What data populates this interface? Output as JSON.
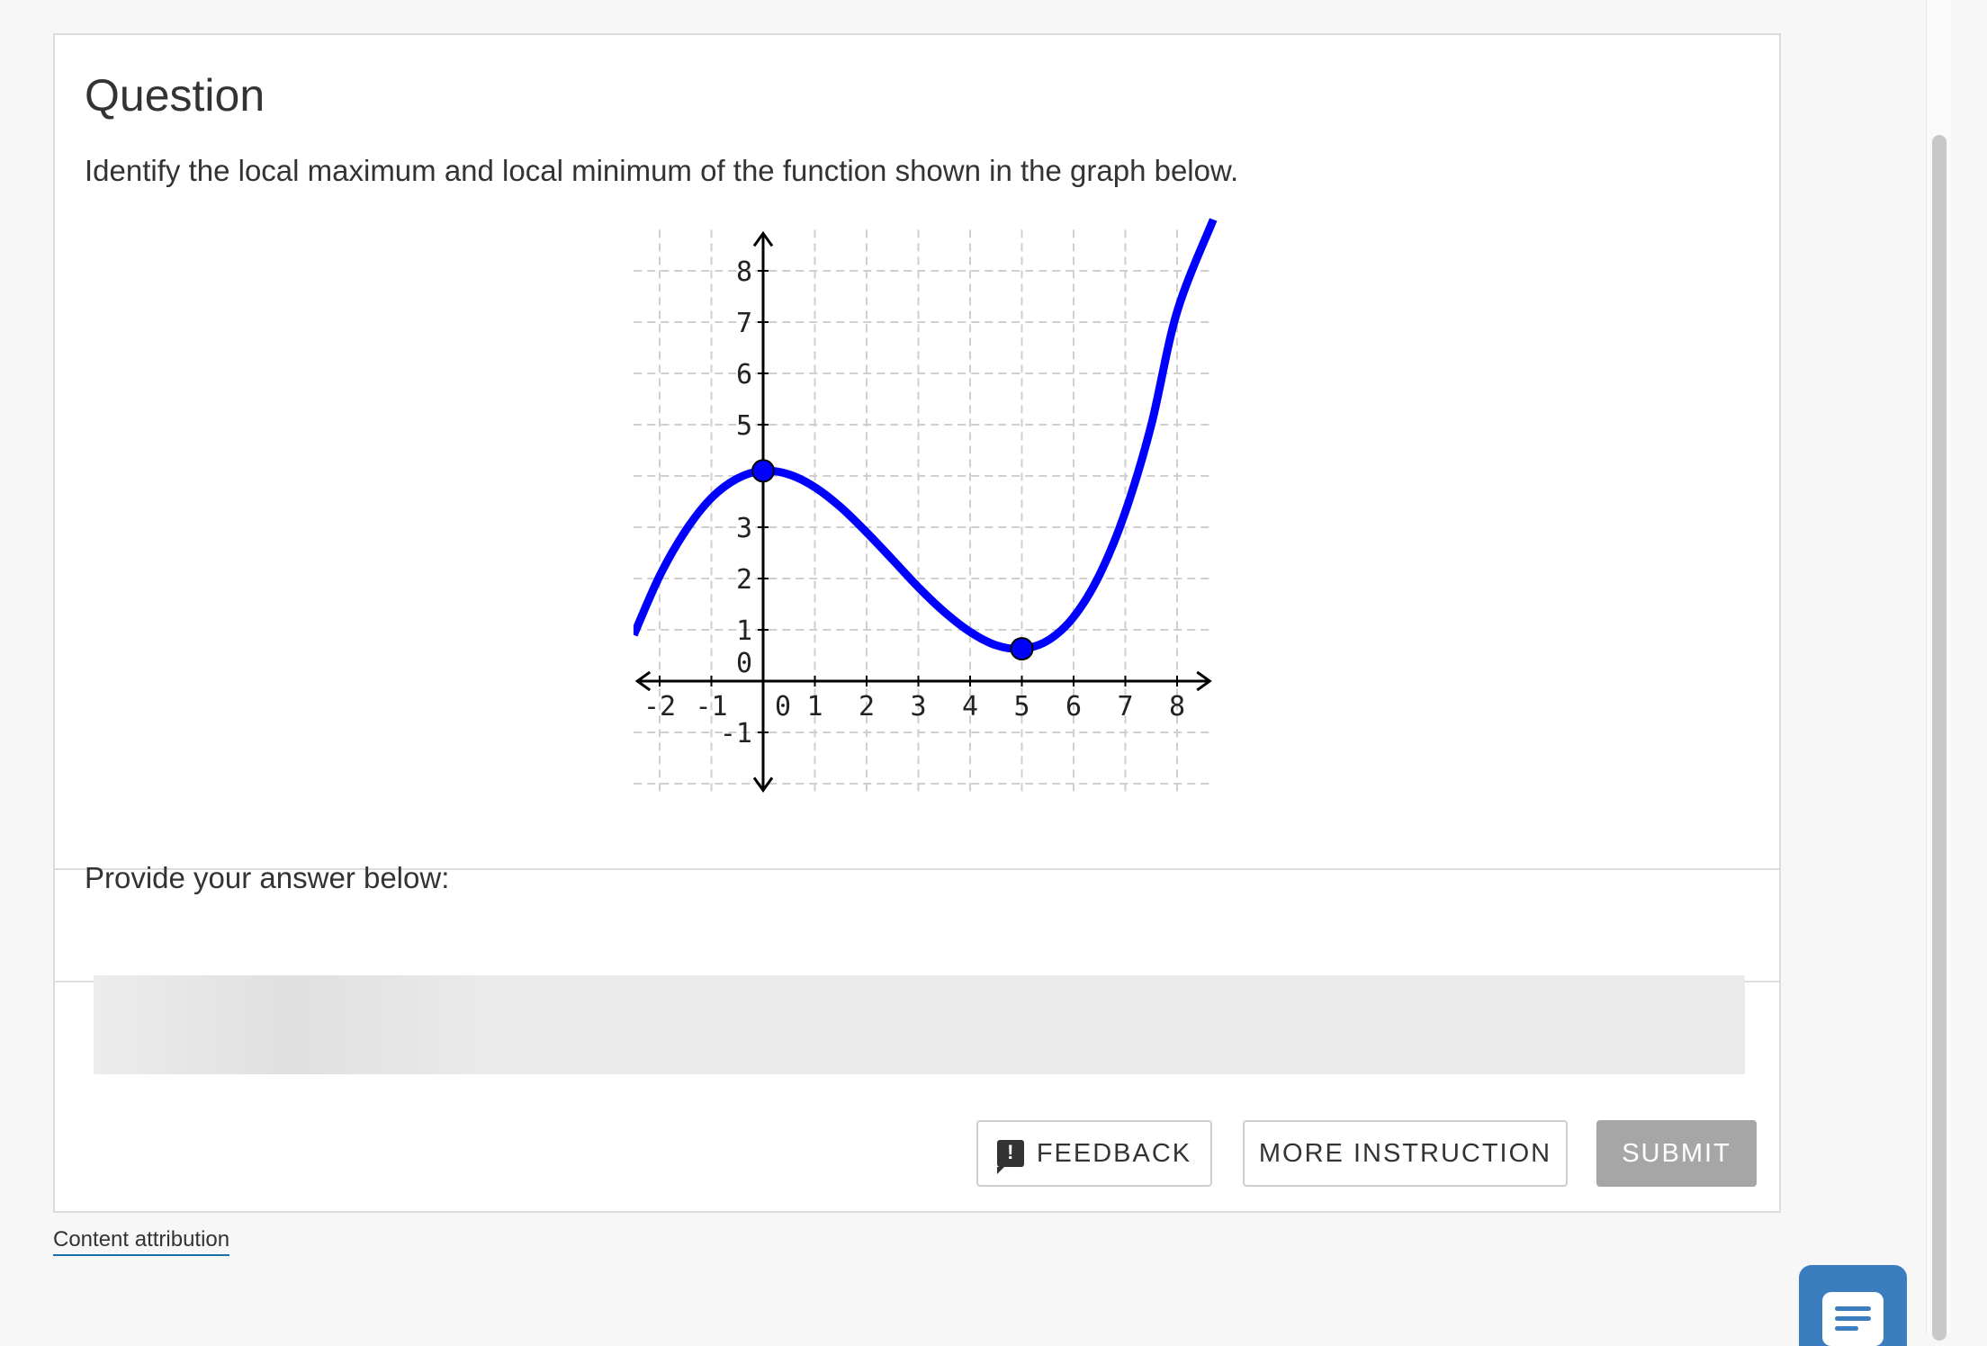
{
  "question": {
    "title": "Question",
    "prompt": "Identify the local maximum and local minimum of the function shown in the graph below."
  },
  "chart_data": {
    "type": "line",
    "title": "",
    "xlabel": "",
    "ylabel": "",
    "xlim": [
      -2.5,
      8.7
    ],
    "ylim": [
      -2.2,
      8.8
    ],
    "x_ticks": [
      "-2",
      "-1",
      "0",
      "1",
      "2",
      "3",
      "4",
      "5",
      "6",
      "7",
      "8"
    ],
    "y_ticks": [
      "8",
      "7",
      "6",
      "5",
      "3",
      "2",
      "1",
      "0",
      "-1"
    ],
    "grid": true,
    "series": [
      {
        "color": "#0000ff",
        "x": [
          -2.5,
          -2,
          -1.5,
          -1,
          -0.5,
          0,
          0.5,
          1,
          1.5,
          2,
          2.5,
          3,
          3.5,
          4,
          4.5,
          5,
          5.5,
          6,
          6.5,
          7,
          7.5,
          8,
          8.7
        ],
        "y": [
          0.9,
          2.05,
          2.93,
          3.57,
          3.95,
          4.1,
          4.03,
          3.78,
          3.39,
          2.9,
          2.37,
          1.83,
          1.35,
          0.96,
          0.7,
          0.63,
          0.79,
          1.25,
          2.07,
          3.3,
          4.99,
          7.2,
          9.0
        ]
      }
    ],
    "points": [
      {
        "x": 0,
        "y": 4.1
      },
      {
        "x": 5,
        "y": 0.63
      }
    ]
  },
  "answer": {
    "label": "Provide your answer below:"
  },
  "buttons": {
    "feedback": "FEEDBACK",
    "more_instruction": "MORE INSTRUCTION",
    "submit": "SUBMIT"
  },
  "footer": {
    "attribution": "Content attribution"
  },
  "icons": {
    "feedback": "feedback-icon",
    "chat": "chat-icon"
  },
  "colors": {
    "curve": "#0000ff",
    "submit_disabled": "#a6a6a6",
    "chat_button": "#3b7ebf"
  }
}
